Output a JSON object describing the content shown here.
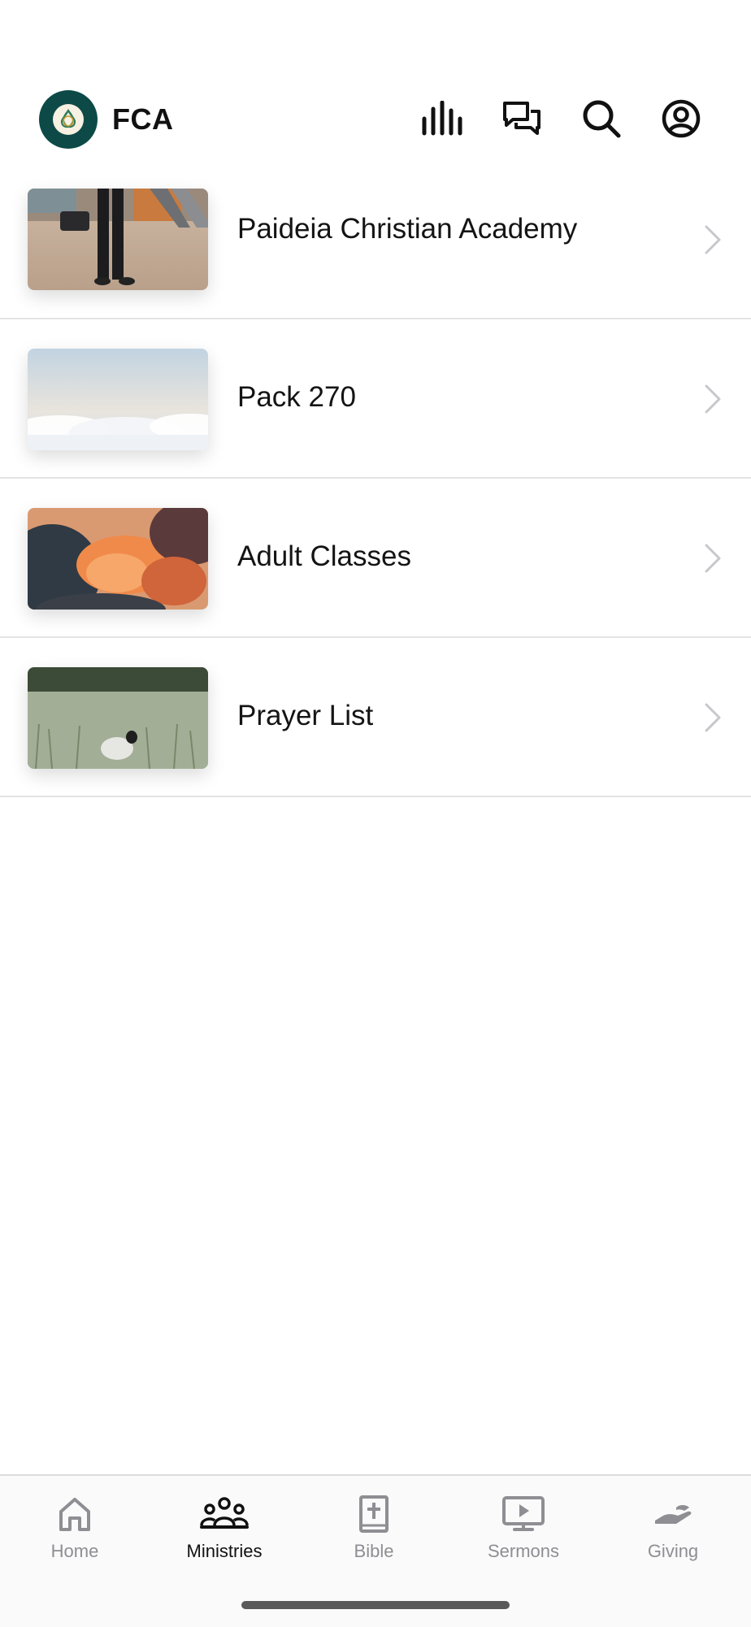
{
  "header": {
    "title": "FCA",
    "icons": [
      "live-icon",
      "chat-icon",
      "search-icon",
      "profile-icon"
    ]
  },
  "ministries": [
    {
      "label": "Paideia Christian Academy",
      "thumb": "person-on-beach-image"
    },
    {
      "label": "Pack 270",
      "thumb": "clouds-sky-image"
    },
    {
      "label": "Adult Classes",
      "thumb": "orange-sunset-clouds-image"
    },
    {
      "label": "Prayer List",
      "thumb": "sheep-in-meadow-image"
    }
  ],
  "tabbar": {
    "active": "Ministries",
    "tabs": [
      {
        "label": "Home",
        "icon": "home-icon"
      },
      {
        "label": "Ministries",
        "icon": "people-icon"
      },
      {
        "label": "Bible",
        "icon": "bible-icon"
      },
      {
        "label": "Sermons",
        "icon": "sermon-play-icon"
      },
      {
        "label": "Giving",
        "icon": "giving-hand-icon"
      }
    ]
  },
  "colors": {
    "brand": "#0d4a47",
    "text": "#111111",
    "inactive": "#8e8e93",
    "divider": "#e4e4e6"
  }
}
